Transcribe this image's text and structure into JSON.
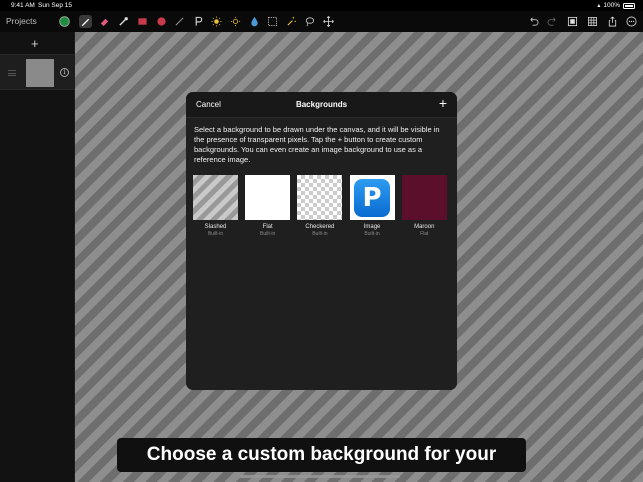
{
  "status_bar": {
    "time": "9:41 AM",
    "date": "Sun Sep 15",
    "battery": "100%"
  },
  "toolbar": {
    "projects_label": "Projects",
    "tools": [
      "color-swatch",
      "brush",
      "eraser",
      "eyedropper",
      "rectangle",
      "ellipse",
      "line",
      "text",
      "brightness",
      "contrast",
      "fill",
      "selection",
      "magic-wand",
      "lasso",
      "move",
      "undo",
      "redo",
      "canvas",
      "grid",
      "share",
      "more"
    ],
    "color_swatch": "#1e8e3e"
  },
  "sidebar": {
    "add_label": "+"
  },
  "modal": {
    "cancel_label": "Cancel",
    "title": "Backgrounds",
    "add_label": "+",
    "description": "Select a background to be drawn under the canvas, and it will be visible in the presence of transparent pixels. Tap the + button to create custom backgrounds. You can even create an image background to use as a reference image.",
    "backgrounds": [
      {
        "name": "Slashed",
        "subtitle": "Built-in"
      },
      {
        "name": "Flat",
        "subtitle": "Built-in"
      },
      {
        "name": "Checkered",
        "subtitle": "Built-in"
      },
      {
        "name": "Image",
        "subtitle": "Built-in"
      },
      {
        "name": "Maroon",
        "subtitle": "Flat"
      }
    ],
    "maroon_color": "#5b0f2b",
    "image_icon_letter": "P"
  },
  "caption": "Choose a custom background for your canvas"
}
